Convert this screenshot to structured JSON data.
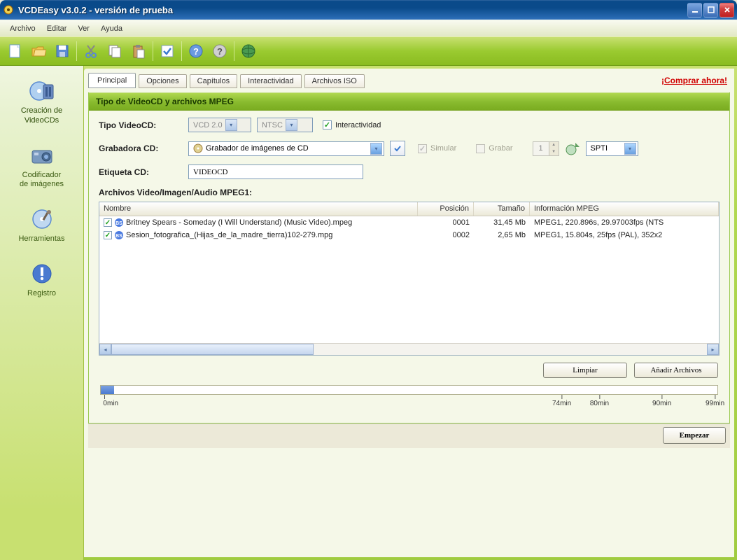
{
  "title": "VCDEasy v3.0.2 - versión de prueba",
  "menu": {
    "archivo": "Archivo",
    "editar": "Editar",
    "ver": "Ver",
    "ayuda": "Ayuda"
  },
  "sidebar": {
    "items": [
      {
        "label": "Creación de\nVideoCDs"
      },
      {
        "label": "Codificador\nde imágenes"
      },
      {
        "label": "Herramientas"
      },
      {
        "label": "Registro"
      }
    ]
  },
  "tabs": {
    "principal": "Principal",
    "opciones": "Opciones",
    "capitulos": "Capítulos",
    "interactividad": "Interactividad",
    "archivos_iso": "Archivos ISO"
  },
  "buy_link": "¡Comprar ahora!",
  "panel_header": "Tipo de VideoCD y archivos MPEG",
  "form": {
    "tipo_label": "Tipo VideoCD:",
    "tipo_value": "VCD 2.0",
    "tv_value": "NTSC",
    "interact_label": "Interactividad",
    "grabadora_label": "Grabadora CD:",
    "grabadora_value": "Grabador de imágenes de CD",
    "simular": "Simular",
    "grabar": "Grabar",
    "copies": "1",
    "spti": "SPTI",
    "etiqueta_label": "Etiqueta CD:",
    "etiqueta_value": "VIDEOCD",
    "files_label": "Archivos Video/Imagen/Audio MPEG1:"
  },
  "list": {
    "headers": {
      "name": "Nombre",
      "pos": "Posición",
      "size": "Tamaño",
      "info": "Información MPEG"
    },
    "rows": [
      {
        "name": "Britney Spears - Someday (I Will Understand) (Music Video).mpeg",
        "pos": "0001",
        "size": "31,45 Mb",
        "info": "MPEG1, 220.896s, 29.97003fps (NTS"
      },
      {
        "name": "Sesion_fotografica_(Hijas_de_la_madre_tierra)102-279.mpg",
        "pos": "0002",
        "size": "2,65 Mb",
        "info": "MPEG1, 15.804s, 25fps (PAL), 352x2"
      }
    ]
  },
  "buttons": {
    "limpiar": "Limpiar",
    "anadir": "Añadir Archivos",
    "empezar": "Empezar"
  },
  "timeline": {
    "t0": "0min",
    "t74": "74min",
    "t80": "80min",
    "t90": "90min",
    "t99": "99min"
  }
}
